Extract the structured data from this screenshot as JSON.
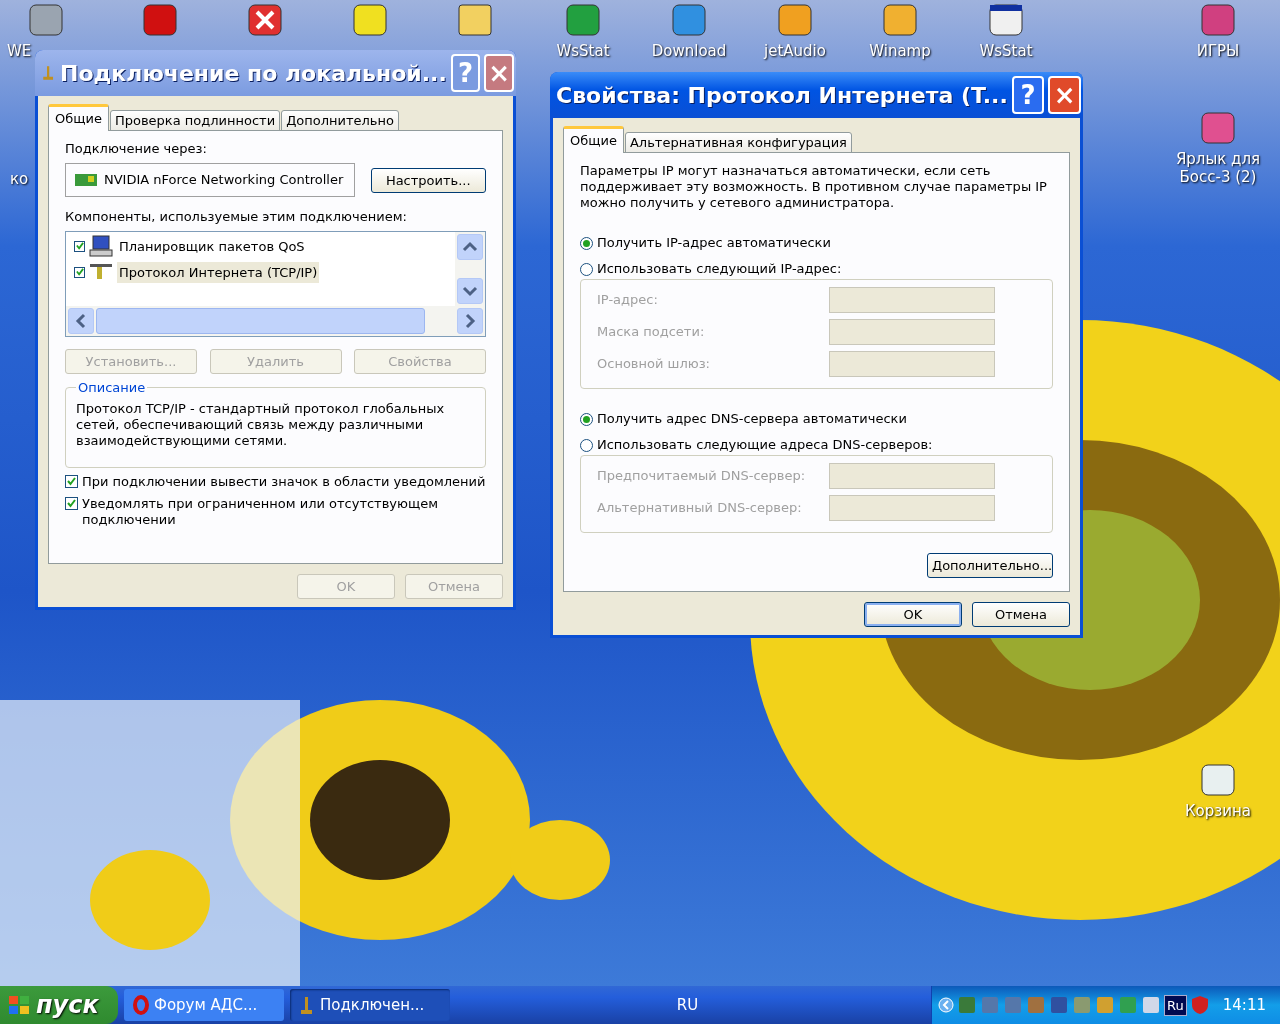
{
  "desktop_icons": [
    {
      "kind": "network",
      "label": "WE"
    },
    {
      "kind": "opera"
    },
    {
      "kind": "redx"
    },
    {
      "kind": "bat"
    },
    {
      "kind": "folder"
    },
    {
      "kind": "wsstat",
      "label": "WsStat"
    },
    {
      "kind": "globe",
      "label": "Download"
    },
    {
      "kind": "jet",
      "label": "jetAudio"
    },
    {
      "kind": "winamp",
      "label": "Winamp"
    },
    {
      "kind": "window",
      "label": "WsStat"
    },
    {
      "kind": "games",
      "label": "ИГРЫ"
    }
  ],
  "side_icons": [
    {
      "kind": "hidden",
      "label": "ко"
    },
    {
      "kind": "boss",
      "label": "Ярлык для Босс-3 (2)"
    },
    {
      "kind": "recycle",
      "label": "Корзина"
    }
  ],
  "connection_dialog": {
    "title": "Подключение по локальной...",
    "help_button": "?",
    "close_button": "×",
    "tabs": [
      {
        "label": "Общие",
        "selected": true
      },
      {
        "label": "Проверка подлинности",
        "selected": false
      },
      {
        "label": "Дополнительно",
        "selected": false
      }
    ],
    "connect_via_label": "Подключение через:",
    "adapter": "NVIDIA nForce Networking Controller",
    "configure_button": "Настроить...",
    "components_label": "Компоненты, используемые этим подключением:",
    "components": [
      {
        "kind": "qos",
        "label": "Планировщик пакетов QoS",
        "checked": true,
        "selected": false
      },
      {
        "kind": "tcp",
        "label": "Протокол Интернета (TCP/IP)",
        "checked": true,
        "selected": true
      }
    ],
    "component_buttons": [
      {
        "label": "Установить...",
        "disabled": true
      },
      {
        "label": "Удалить",
        "disabled": true
      },
      {
        "label": "Свойства",
        "disabled": true
      }
    ],
    "description_title": "Описание",
    "description": "Протокол TCP/IP - стандартный протокол глобальных сетей, обеспечивающий связь между различными взаимодействующими сетями.",
    "options": [
      {
        "label": "При подключении вывести значок в области уведомлений",
        "checked": true
      },
      {
        "label": "Уведомлять при ограниченном или отсутствующем подключении",
        "checked": true
      }
    ],
    "buttons": [
      {
        "label": "OK",
        "disabled": true
      },
      {
        "label": "Отмена",
        "disabled": true
      }
    ]
  },
  "tcp_dialog": {
    "title": "Свойства: Протокол Интернета (T...",
    "help_button": "?",
    "close_button": "×",
    "tabs": [
      {
        "label": "Общие",
        "selected": true
      },
      {
        "label": "Альтернативная конфигурация",
        "selected": false
      }
    ],
    "intro": "Параметры IP могут назначаться автоматически, если сеть поддерживает эту возможность. В противном случае параметры IP можно получить у сетевого администратора.",
    "ip_radios": [
      {
        "label": "Получить IP-адрес автоматически",
        "selected": true
      },
      {
        "label": "Использовать следующий IP-адрес:",
        "selected": false
      }
    ],
    "ip_fields": [
      {
        "label": "IP-адрес:",
        "disabled": true
      },
      {
        "label": "Маска подсети:",
        "disabled": true
      },
      {
        "label": "Основной шлюз:",
        "disabled": true
      }
    ],
    "dns_radios": [
      {
        "label": "Получить адрес DNS-сервера автоматически",
        "selected": true
      },
      {
        "label": "Использовать следующие адреса DNS-серверов:",
        "selected": false
      }
    ],
    "dns_fields": [
      {
        "label": "Предпочитаемый DNS-сервер:",
        "disabled": true
      },
      {
        "label": "Альтернативный DNS-сервер:",
        "disabled": true
      }
    ],
    "advanced_button": "Дополнительно...",
    "buttons": [
      {
        "label": "OK",
        "default": true
      },
      {
        "label": "Отмена",
        "default": false
      }
    ]
  },
  "taskbar": {
    "start": "пуск",
    "tasks": [
      {
        "kind": "opera",
        "label": "Форум АДС...",
        "selected": false
      },
      {
        "kind": "net",
        "label": "Подключен...",
        "selected": true
      }
    ],
    "language": "RU",
    "tray": [
      {
        "color": "#3a7a3a"
      },
      {
        "color": "#5577aa"
      },
      {
        "color": "#5577aa"
      },
      {
        "color": "#a07040"
      },
      {
        "color": "#3050a0"
      },
      {
        "color": "#8a9a70"
      },
      {
        "color": "#d0a030"
      },
      {
        "color": "#30a050"
      },
      {
        "color": "#d0d8e8"
      }
    ],
    "tray_lang": "Ru",
    "clock": "14:11"
  }
}
